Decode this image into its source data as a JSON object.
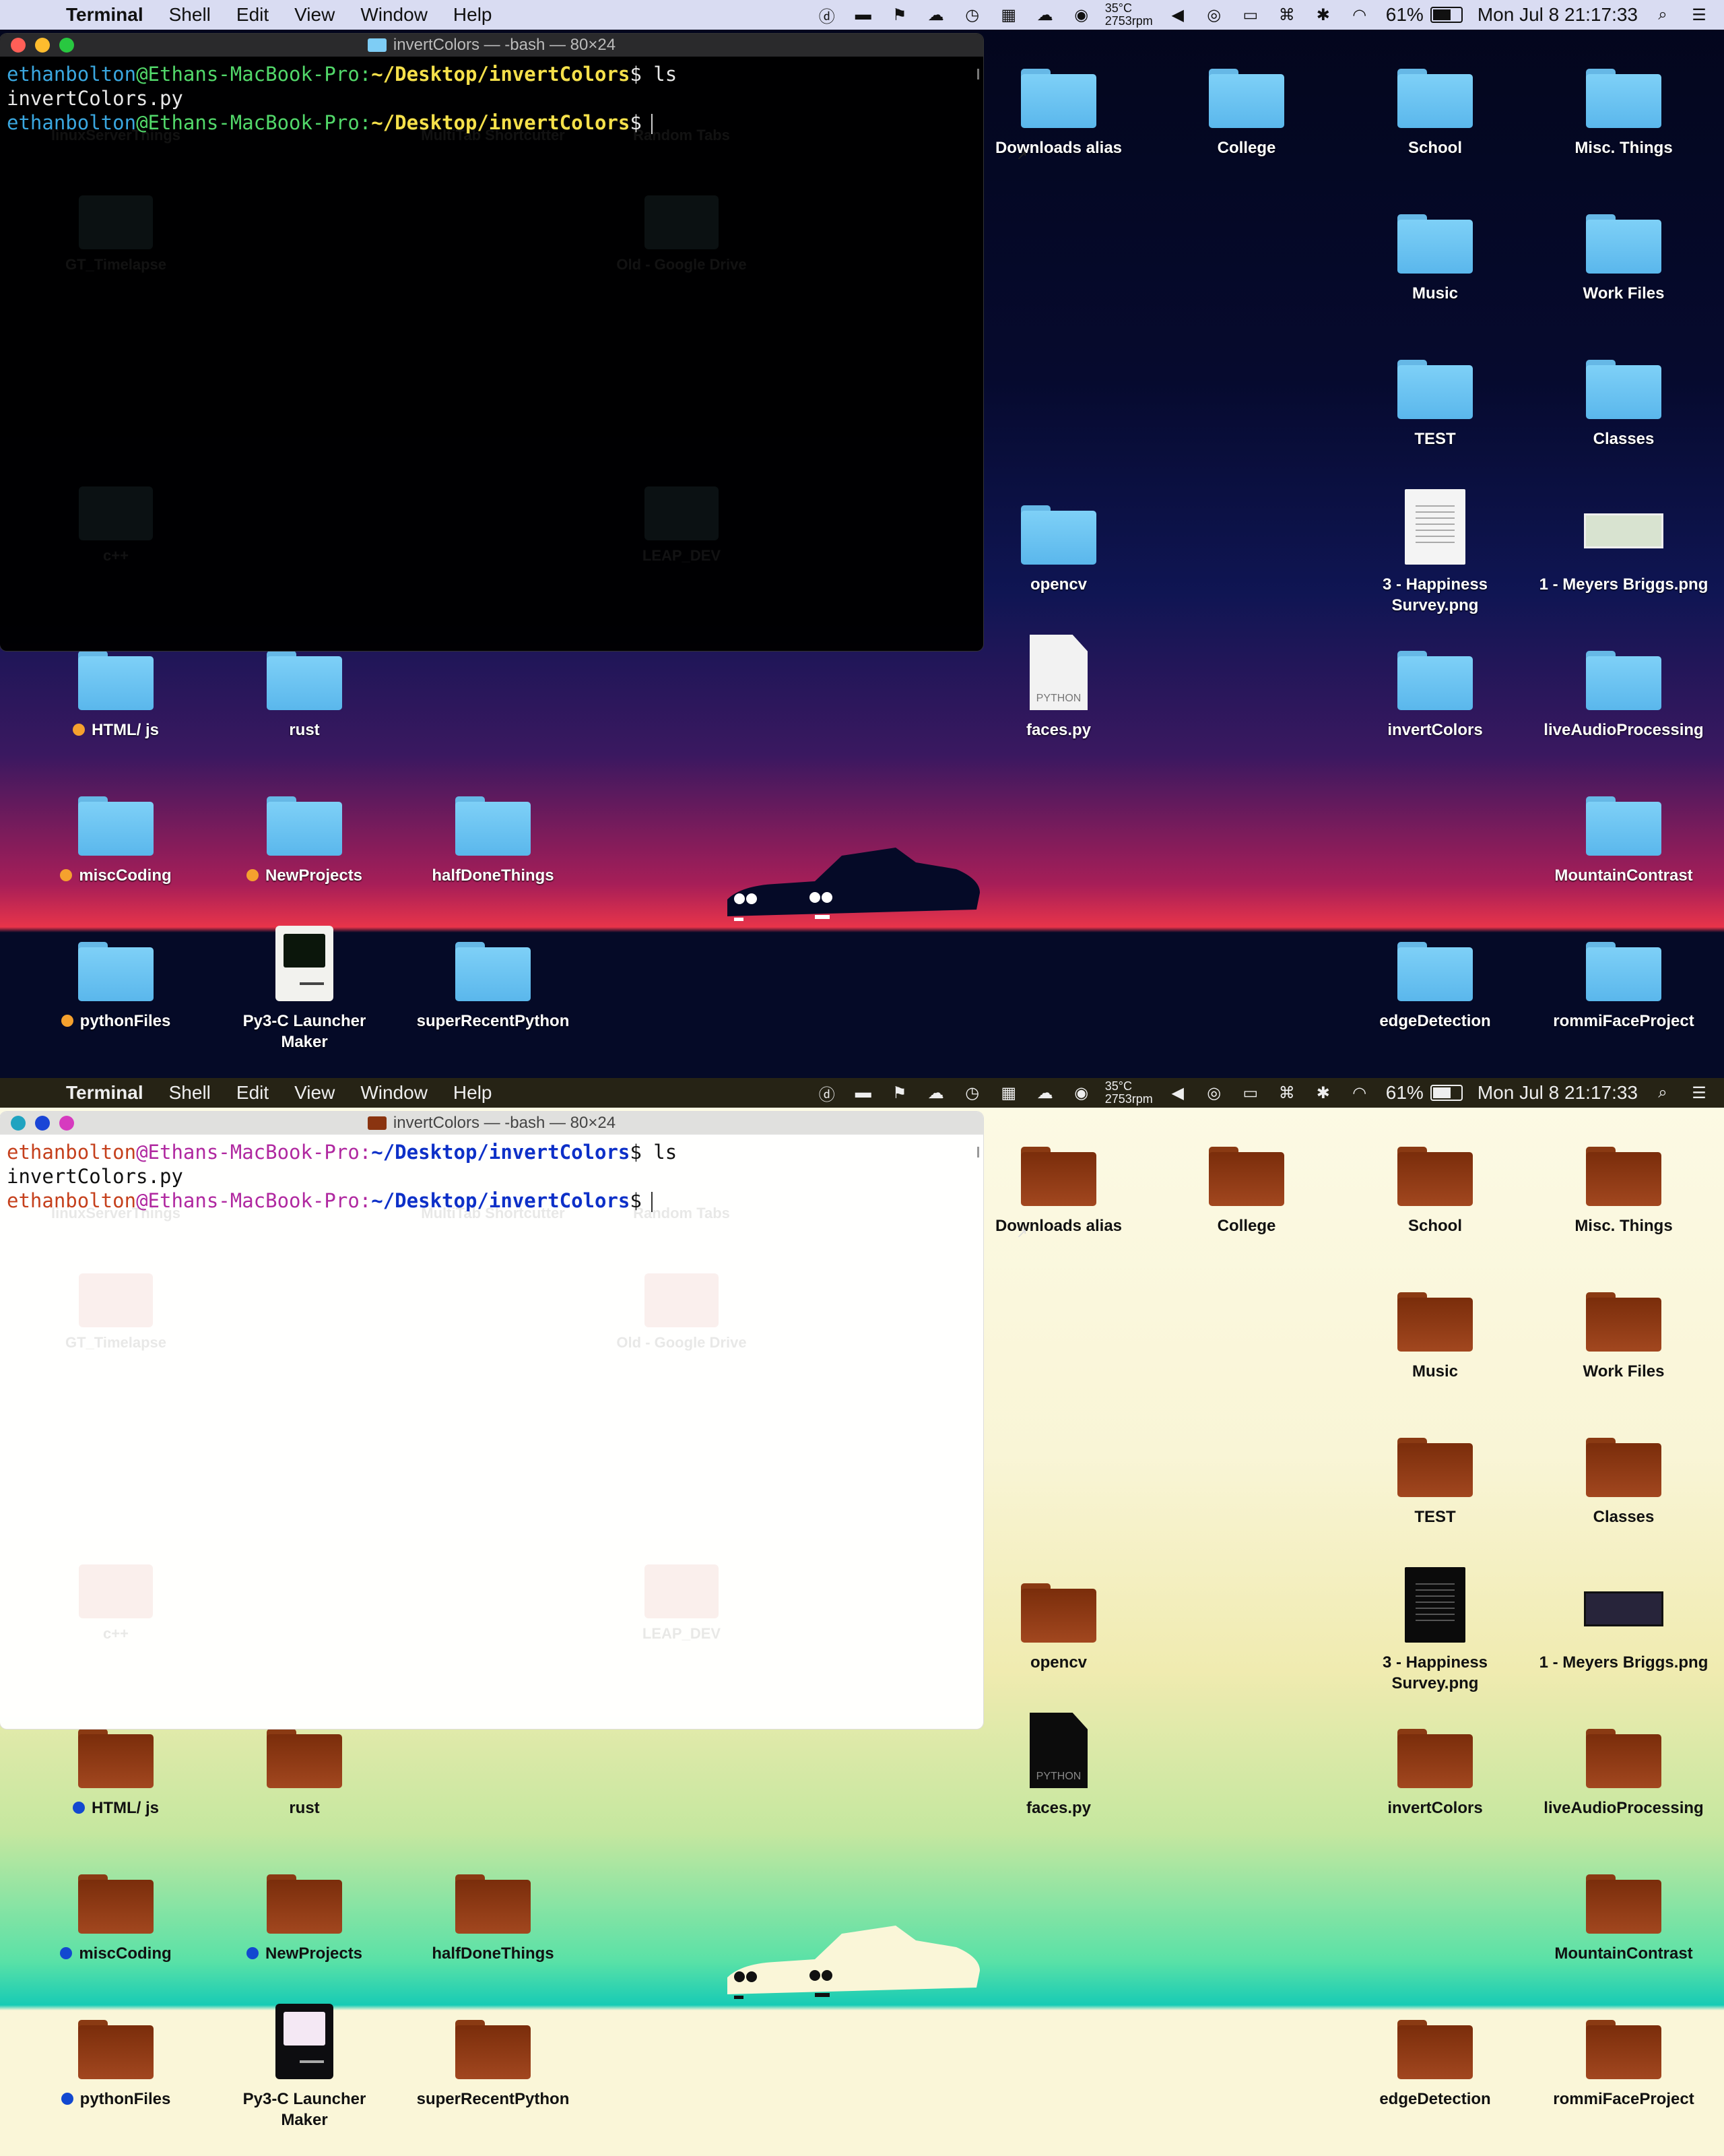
{
  "panels": [
    {
      "theme": "dark",
      "menubar": {
        "app": "Terminal",
        "items": [
          "Shell",
          "Edit",
          "View",
          "Window",
          "Help"
        ],
        "temp_line1": "35°C",
        "temp_line2": "2753rpm",
        "battery": "61%",
        "clock": "Mon Jul 8  21:17:33"
      },
      "terminal": {
        "title": "invertColors — -bash — 80×24",
        "line1_user": "ethanbolton",
        "line1_host": "@Ethans-MacBook-Pro:",
        "line1_path": "~/Desktop/invertColors",
        "line1_cmd": "$ ls",
        "line2": "invertColors.py",
        "line3_user": "ethanbolton",
        "line3_host": "@Ethans-MacBook-Pro:",
        "line3_path": "~/Desktop/invertColors",
        "line3_cmd": "$"
      }
    },
    {
      "theme": "light",
      "menubar": {
        "app": "Terminal",
        "items": [
          "Shell",
          "Edit",
          "View",
          "Window",
          "Help"
        ],
        "temp_line1": "35°C",
        "temp_line2": "2753rpm",
        "battery": "61%",
        "clock": "Mon Jul 8  21:17:33"
      },
      "terminal": {
        "title": "invertColors — -bash — 80×24",
        "line1_user": "ethanbolton",
        "line1_host": "@Ethans-MacBook-Pro:",
        "line1_path": "~/Desktop/invertColors",
        "line1_cmd": "$ ls",
        "line2": "invertColors.py",
        "line3_user": "ethanbolton",
        "line3_host": "@Ethans-MacBook-Pro:",
        "line3_path": "~/Desktop/invertColors",
        "line3_cmd": "$"
      }
    }
  ],
  "ghost_icons": [
    "linuxServerThings",
    "MultiTab Shortcutter",
    "Random Tabs",
    "GT_Timelapse",
    "Old - Google Drive",
    "c++",
    "LEAP_DEV"
  ],
  "icons": {
    "downloads_alias": "Downloads alias",
    "college": "College",
    "school": "School",
    "misc_things": "Misc. Things",
    "music": "Music",
    "work_files": "Work Files",
    "test": "TEST",
    "classes": "Classes",
    "opencv": "opencv",
    "happiness_1": "3 - Happiness",
    "happiness_2": "Survey.png",
    "meyers": "1 - Meyers Briggs.png",
    "faces": "faces.py",
    "python_tag": "PYTHON",
    "invertcolors": "invertColors",
    "liveaudio": "liveAudioProcessing",
    "html_js": "HTML/ js",
    "rust": "rust",
    "misccoding": "miscCoding",
    "newprojects": "NewProjects",
    "halfdone": "halfDoneThings",
    "mountain": "MountainContrast",
    "pythonfiles": "pythonFiles",
    "py3c_1": "Py3-C Launcher",
    "py3c_2": "Maker",
    "superrecent": "superRecentPython",
    "edgedetection": "edgeDetection",
    "rommi": "rommiFaceProject"
  },
  "colors": {
    "dark_folder": "#7ed0f7",
    "light_folder": "#8a3410",
    "dark_tag": "#f5a12e",
    "light_tag": "#1248d0"
  }
}
